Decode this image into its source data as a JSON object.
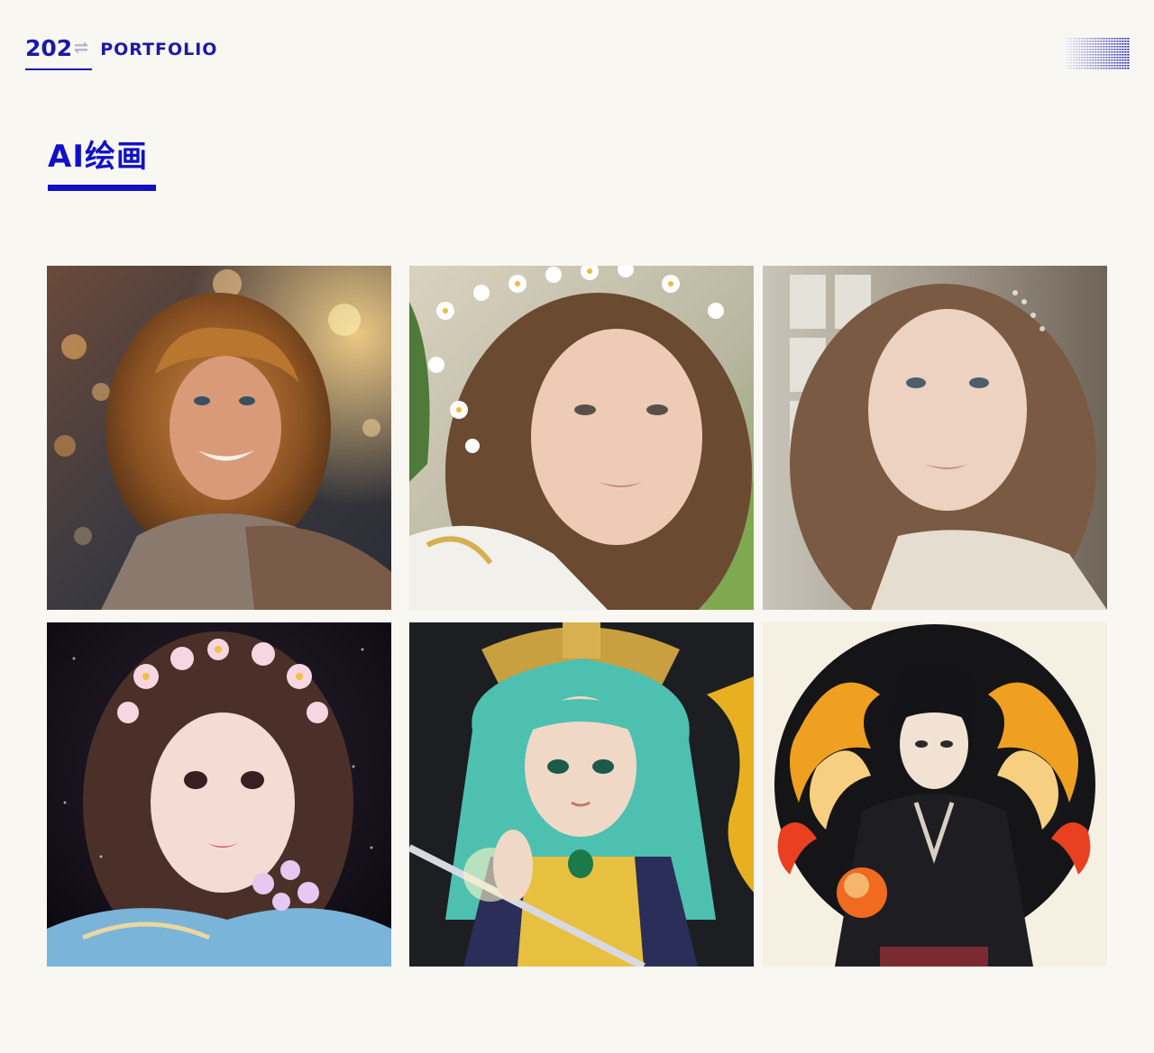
{
  "header": {
    "year": "202",
    "portfolio_label": "PORTFOLIO"
  },
  "section": {
    "title": "AI绘画"
  },
  "gallery": {
    "items": [
      {
        "name": "artwork-curly-hair-woman-portrait"
      },
      {
        "name": "artwork-flower-crown-woman-portrait"
      },
      {
        "name": "artwork-window-light-woman-portrait"
      },
      {
        "name": "artwork-hanfu-girl-flowers"
      },
      {
        "name": "artwork-anime-teal-hair-warrior"
      },
      {
        "name": "artwork-anime-man-fire-orb"
      }
    ]
  },
  "colors": {
    "brand_blue": "#1a1aa8",
    "title_blue": "#1010c8",
    "background": "#f8f7f2"
  }
}
